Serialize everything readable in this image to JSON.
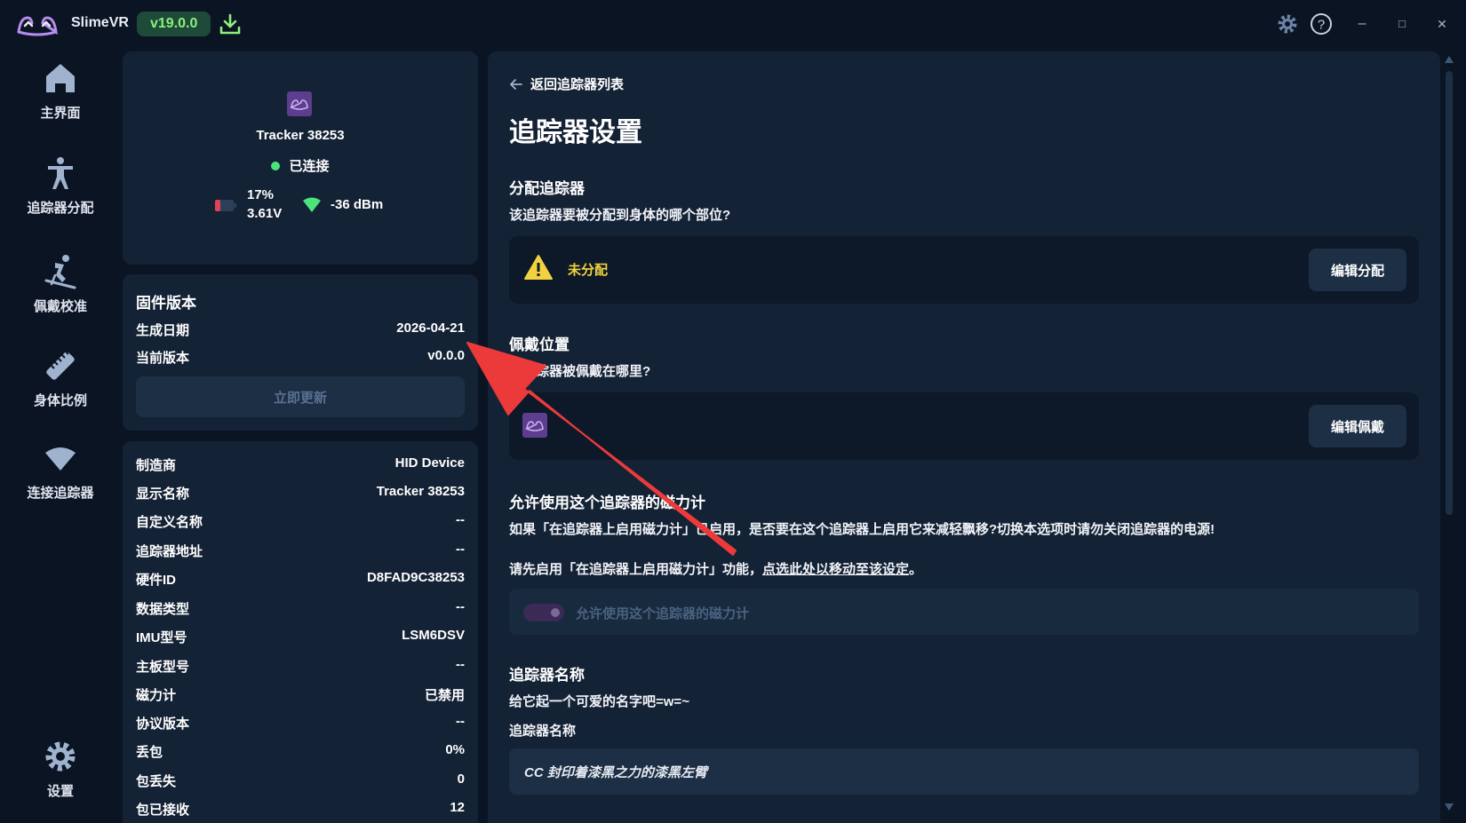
{
  "titlebar": {
    "app_name": "SlimeVR",
    "version": "v19.0.0",
    "icons": [
      "slimevr-logo-icon",
      "download-icon",
      "settings-gear-icon",
      "help-icon",
      "minimize-icon",
      "maximize-icon",
      "close-icon"
    ],
    "minimize_glyph": "–",
    "maximize_glyph": "□",
    "close_glyph": "✕"
  },
  "sidebar": {
    "items": [
      {
        "label": "主界面",
        "icon": "home-icon"
      },
      {
        "label": "追踪器分配",
        "icon": "person-icon"
      },
      {
        "label": "佩戴校准",
        "icon": "skier-icon"
      },
      {
        "label": "身体比例",
        "icon": "ruler-icon"
      },
      {
        "label": "连接追踪器",
        "icon": "wifi-icon"
      }
    ],
    "settings_label": "设置"
  },
  "tracker": {
    "name": "Tracker 38253",
    "status": "已连接",
    "battery_percent": "17%",
    "battery_voltage": "3.61V",
    "signal": "-36 dBm",
    "status_color": "#49e57a"
  },
  "firmware": {
    "title": "固件版本",
    "rows": [
      {
        "key": "生成日期",
        "value": "2026-04-21"
      },
      {
        "key": "当前版本",
        "value": "v0.0.0"
      }
    ],
    "update_button": "立即更新"
  },
  "info": {
    "rows": [
      {
        "key": "制造商",
        "value": "HID Device"
      },
      {
        "key": "显示名称",
        "value": "Tracker 38253"
      },
      {
        "key": "自定义名称",
        "value": "--"
      },
      {
        "key": "追踪器地址",
        "value": "--"
      },
      {
        "key": "硬件ID",
        "value": "D8FAD9C38253"
      },
      {
        "key": "数据类型",
        "value": "--"
      },
      {
        "key": "IMU型号",
        "value": "LSM6DSV"
      },
      {
        "key": "主板型号",
        "value": "--"
      },
      {
        "key": "磁力计",
        "value": "已禁用"
      },
      {
        "key": "协议版本",
        "value": "--"
      },
      {
        "key": "丢包",
        "value": "0%"
      },
      {
        "key": "包丢失",
        "value": "0"
      },
      {
        "key": "包已接收",
        "value": "12"
      }
    ]
  },
  "main": {
    "back_label": "返回追踪器列表",
    "title": "追踪器设置",
    "assign": {
      "heading": "分配追踪器",
      "question": "该追踪器要被分配到身体的哪个部位?",
      "status": "未分配",
      "button": "编辑分配"
    },
    "mounting": {
      "heading": "佩戴位置",
      "question": "该追踪器被佩戴在哪里?",
      "button": "编辑佩戴"
    },
    "magnetometer": {
      "heading": "允许使用这个追踪器的磁力计",
      "description": "如果「在追踪器上启用磁力计」已启用，是否要在这个追踪器上启用它来减轻飘移?切换本选项时请勿关闭追踪器的电源!",
      "hint_prefix": "请先启用「在追踪器上启用磁力计」功能，",
      "hint_link": "点选此处以移动至该设定",
      "hint_suffix": "。",
      "toggle_label": "允许使用这个追踪器的磁力计"
    },
    "name_section": {
      "heading": "追踪器名称",
      "subtitle": "给它起一个可爱的名字吧=w=~",
      "field_label": "追踪器名称",
      "field_value": "CC 封印着漆黑之力的漆黑左臂"
    }
  },
  "colors": {
    "background": "#0b1422",
    "panel": "#142235",
    "accent_green": "#8ef07b",
    "warning_yellow": "#f3d23f",
    "arrow_red": "#ec3a3a"
  }
}
